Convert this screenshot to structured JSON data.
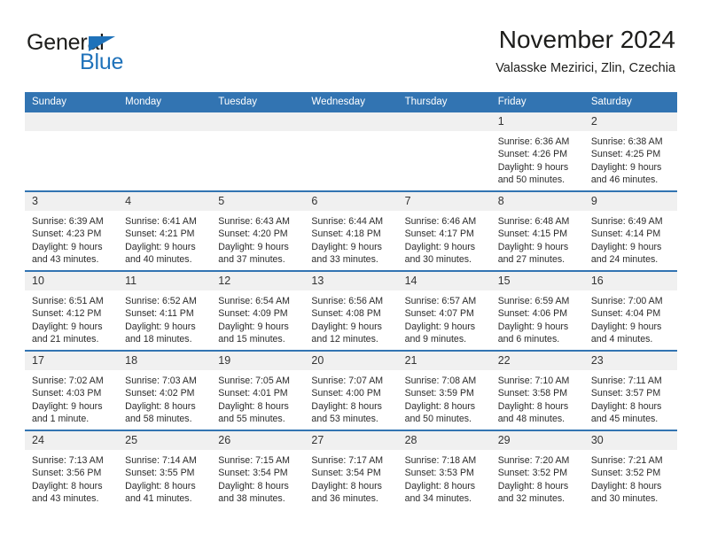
{
  "brand": {
    "name_part1": "General",
    "name_part2": "Blue",
    "logo_icon": "triangle-flag-icon",
    "accent_color": "#1f72ba"
  },
  "header": {
    "title": "November 2024",
    "subtitle": "Valasske Mezirici, Zlin, Czechia",
    "header_bg_color": "#3274b2",
    "daynum_bg_color": "#f0f0f0"
  },
  "weekday_headers": [
    "Sunday",
    "Monday",
    "Tuesday",
    "Wednesday",
    "Thursday",
    "Friday",
    "Saturday"
  ],
  "labels": {
    "sunrise_prefix": "Sunrise:",
    "sunset_prefix": "Sunset:",
    "daylight_prefix": "Daylight:"
  },
  "weeks": [
    [
      {
        "day": "",
        "blank": true,
        "sunrise": "",
        "sunset": "",
        "daylight": ""
      },
      {
        "day": "",
        "blank": true,
        "sunrise": "",
        "sunset": "",
        "daylight": ""
      },
      {
        "day": "",
        "blank": true,
        "sunrise": "",
        "sunset": "",
        "daylight": ""
      },
      {
        "day": "",
        "blank": true,
        "sunrise": "",
        "sunset": "",
        "daylight": ""
      },
      {
        "day": "",
        "blank": true,
        "sunrise": "",
        "sunset": "",
        "daylight": ""
      },
      {
        "day": "1",
        "blank": false,
        "sunrise": "Sunrise: 6:36 AM",
        "sunset": "Sunset: 4:26 PM",
        "daylight": "Daylight: 9 hours and 50 minutes."
      },
      {
        "day": "2",
        "blank": false,
        "sunrise": "Sunrise: 6:38 AM",
        "sunset": "Sunset: 4:25 PM",
        "daylight": "Daylight: 9 hours and 46 minutes."
      }
    ],
    [
      {
        "day": "3",
        "blank": false,
        "sunrise": "Sunrise: 6:39 AM",
        "sunset": "Sunset: 4:23 PM",
        "daylight": "Daylight: 9 hours and 43 minutes."
      },
      {
        "day": "4",
        "blank": false,
        "sunrise": "Sunrise: 6:41 AM",
        "sunset": "Sunset: 4:21 PM",
        "daylight": "Daylight: 9 hours and 40 minutes."
      },
      {
        "day": "5",
        "blank": false,
        "sunrise": "Sunrise: 6:43 AM",
        "sunset": "Sunset: 4:20 PM",
        "daylight": "Daylight: 9 hours and 37 minutes."
      },
      {
        "day": "6",
        "blank": false,
        "sunrise": "Sunrise: 6:44 AM",
        "sunset": "Sunset: 4:18 PM",
        "daylight": "Daylight: 9 hours and 33 minutes."
      },
      {
        "day": "7",
        "blank": false,
        "sunrise": "Sunrise: 6:46 AM",
        "sunset": "Sunset: 4:17 PM",
        "daylight": "Daylight: 9 hours and 30 minutes."
      },
      {
        "day": "8",
        "blank": false,
        "sunrise": "Sunrise: 6:48 AM",
        "sunset": "Sunset: 4:15 PM",
        "daylight": "Daylight: 9 hours and 27 minutes."
      },
      {
        "day": "9",
        "blank": false,
        "sunrise": "Sunrise: 6:49 AM",
        "sunset": "Sunset: 4:14 PM",
        "daylight": "Daylight: 9 hours and 24 minutes."
      }
    ],
    [
      {
        "day": "10",
        "blank": false,
        "sunrise": "Sunrise: 6:51 AM",
        "sunset": "Sunset: 4:12 PM",
        "daylight": "Daylight: 9 hours and 21 minutes."
      },
      {
        "day": "11",
        "blank": false,
        "sunrise": "Sunrise: 6:52 AM",
        "sunset": "Sunset: 4:11 PM",
        "daylight": "Daylight: 9 hours and 18 minutes."
      },
      {
        "day": "12",
        "blank": false,
        "sunrise": "Sunrise: 6:54 AM",
        "sunset": "Sunset: 4:09 PM",
        "daylight": "Daylight: 9 hours and 15 minutes."
      },
      {
        "day": "13",
        "blank": false,
        "sunrise": "Sunrise: 6:56 AM",
        "sunset": "Sunset: 4:08 PM",
        "daylight": "Daylight: 9 hours and 12 minutes."
      },
      {
        "day": "14",
        "blank": false,
        "sunrise": "Sunrise: 6:57 AM",
        "sunset": "Sunset: 4:07 PM",
        "daylight": "Daylight: 9 hours and 9 minutes."
      },
      {
        "day": "15",
        "blank": false,
        "sunrise": "Sunrise: 6:59 AM",
        "sunset": "Sunset: 4:06 PM",
        "daylight": "Daylight: 9 hours and 6 minutes."
      },
      {
        "day": "16",
        "blank": false,
        "sunrise": "Sunrise: 7:00 AM",
        "sunset": "Sunset: 4:04 PM",
        "daylight": "Daylight: 9 hours and 4 minutes."
      }
    ],
    [
      {
        "day": "17",
        "blank": false,
        "sunrise": "Sunrise: 7:02 AM",
        "sunset": "Sunset: 4:03 PM",
        "daylight": "Daylight: 9 hours and 1 minute."
      },
      {
        "day": "18",
        "blank": false,
        "sunrise": "Sunrise: 7:03 AM",
        "sunset": "Sunset: 4:02 PM",
        "daylight": "Daylight: 8 hours and 58 minutes."
      },
      {
        "day": "19",
        "blank": false,
        "sunrise": "Sunrise: 7:05 AM",
        "sunset": "Sunset: 4:01 PM",
        "daylight": "Daylight: 8 hours and 55 minutes."
      },
      {
        "day": "20",
        "blank": false,
        "sunrise": "Sunrise: 7:07 AM",
        "sunset": "Sunset: 4:00 PM",
        "daylight": "Daylight: 8 hours and 53 minutes."
      },
      {
        "day": "21",
        "blank": false,
        "sunrise": "Sunrise: 7:08 AM",
        "sunset": "Sunset: 3:59 PM",
        "daylight": "Daylight: 8 hours and 50 minutes."
      },
      {
        "day": "22",
        "blank": false,
        "sunrise": "Sunrise: 7:10 AM",
        "sunset": "Sunset: 3:58 PM",
        "daylight": "Daylight: 8 hours and 48 minutes."
      },
      {
        "day": "23",
        "blank": false,
        "sunrise": "Sunrise: 7:11 AM",
        "sunset": "Sunset: 3:57 PM",
        "daylight": "Daylight: 8 hours and 45 minutes."
      }
    ],
    [
      {
        "day": "24",
        "blank": false,
        "sunrise": "Sunrise: 7:13 AM",
        "sunset": "Sunset: 3:56 PM",
        "daylight": "Daylight: 8 hours and 43 minutes."
      },
      {
        "day": "25",
        "blank": false,
        "sunrise": "Sunrise: 7:14 AM",
        "sunset": "Sunset: 3:55 PM",
        "daylight": "Daylight: 8 hours and 41 minutes."
      },
      {
        "day": "26",
        "blank": false,
        "sunrise": "Sunrise: 7:15 AM",
        "sunset": "Sunset: 3:54 PM",
        "daylight": "Daylight: 8 hours and 38 minutes."
      },
      {
        "day": "27",
        "blank": false,
        "sunrise": "Sunrise: 7:17 AM",
        "sunset": "Sunset: 3:54 PM",
        "daylight": "Daylight: 8 hours and 36 minutes."
      },
      {
        "day": "28",
        "blank": false,
        "sunrise": "Sunrise: 7:18 AM",
        "sunset": "Sunset: 3:53 PM",
        "daylight": "Daylight: 8 hours and 34 minutes."
      },
      {
        "day": "29",
        "blank": false,
        "sunrise": "Sunrise: 7:20 AM",
        "sunset": "Sunset: 3:52 PM",
        "daylight": "Daylight: 8 hours and 32 minutes."
      },
      {
        "day": "30",
        "blank": false,
        "sunrise": "Sunrise: 7:21 AM",
        "sunset": "Sunset: 3:52 PM",
        "daylight": "Daylight: 8 hours and 30 minutes."
      }
    ]
  ]
}
